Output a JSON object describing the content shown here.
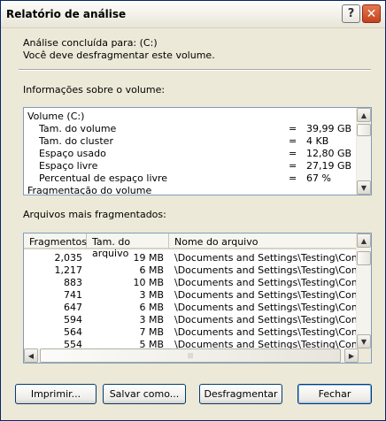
{
  "window": {
    "title": "Relatório de análise",
    "help_glyph": "?",
    "close_glyph": "✕"
  },
  "summary": {
    "line1": "Análise concluída para: (C:)",
    "line2": "Você deve desfragmentar este volume."
  },
  "volume_info": {
    "label": "Informações sobre o volume:",
    "rows": [
      {
        "name": "Volume (C:)",
        "eq": "",
        "value": "",
        "indent": 0
      },
      {
        "name": "Tam. do volume",
        "eq": "=",
        "value": "39,99 GB",
        "indent": 1
      },
      {
        "name": "Tam. do cluster",
        "eq": "=",
        "value": "4 KB",
        "indent": 1
      },
      {
        "name": "Espaço usado",
        "eq": "=",
        "value": "12,80 GB",
        "indent": 1
      },
      {
        "name": "Espaço livre",
        "eq": "=",
        "value": "27,19 GB",
        "indent": 1
      },
      {
        "name": "Percentual de espaço livre",
        "eq": "=",
        "value": "67 %",
        "indent": 1
      },
      {
        "name": "Fragmentação do volume",
        "eq": "",
        "value": "",
        "indent": 0
      }
    ]
  },
  "fragmented_files": {
    "label": "Arquivos mais fragmentados:",
    "columns": [
      "Fragmentos",
      "Tam. do arquivo",
      "Nome do arquivo"
    ],
    "rows": [
      {
        "fragments": "2,035",
        "size": "19 MB",
        "name": "\\Documents and Settings\\Testing\\Config..."
      },
      {
        "fragments": "1,217",
        "size": "6 MB",
        "name": "\\Documents and Settings\\Testing\\Config..."
      },
      {
        "fragments": "883",
        "size": "10 MB",
        "name": "\\Documents and Settings\\Testing\\Config..."
      },
      {
        "fragments": "741",
        "size": "3 MB",
        "name": "\\Documents and Settings\\Testing\\Config..."
      },
      {
        "fragments": "647",
        "size": "6 MB",
        "name": "\\Documents and Settings\\Testing\\Config..."
      },
      {
        "fragments": "594",
        "size": "3 MB",
        "name": "\\Documents and Settings\\Testing\\Config..."
      },
      {
        "fragments": "564",
        "size": "7 MB",
        "name": "\\Documents and Settings\\Testing\\Config..."
      },
      {
        "fragments": "554",
        "size": "5 MB",
        "name": "\\Documents and Settings\\Testing\\Config..."
      }
    ]
  },
  "buttons": {
    "print": "Imprimir...",
    "save_as": "Salvar como...",
    "defragment": "Desfragmentar",
    "close": "Fechar"
  },
  "icons": {
    "scroll_up": "▲",
    "scroll_down": "▼",
    "scroll_left": "◀",
    "scroll_right": "▶",
    "grip": "|||"
  },
  "colors": {
    "title_close": "#c4421d",
    "border_focus": "#7f9db9",
    "dialog_bg": "#ece9d8"
  }
}
